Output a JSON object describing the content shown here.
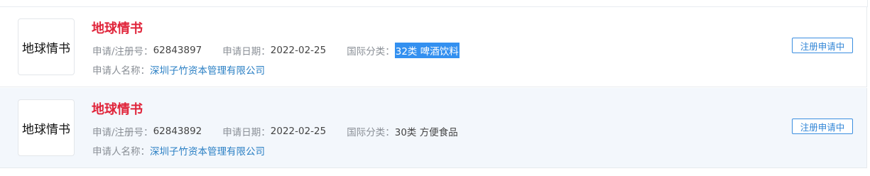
{
  "results": [
    {
      "logo_text": "地球情书",
      "name": "地球情书",
      "reg_label": "申请/注册号：",
      "reg_no": "62843897",
      "date_label": "申请日期：",
      "date": "2022-02-25",
      "class_label": "国际分类：",
      "class": "32类 啤酒饮料",
      "applicant_label": "申请人名称：",
      "applicant": "深圳子竹资本管理有限公司",
      "status": "注册申请中"
    },
    {
      "logo_text": "地球情书",
      "name": "地球情书",
      "reg_label": "申请/注册号：",
      "reg_no": "62843892",
      "date_label": "申请日期：",
      "date": "2022-02-25",
      "class_label": "国际分类：",
      "class": "30类 方便食品",
      "applicant_label": "申请人名称：",
      "applicant": "深圳子竹资本管理有限公司",
      "status": "注册申请中"
    }
  ],
  "colors": {
    "name": "#e0243a",
    "link": "#2a7fc4",
    "status_border": "#3a8ee0",
    "selection": "#3390f0",
    "alt_row_bg": "#f3f7fc"
  }
}
